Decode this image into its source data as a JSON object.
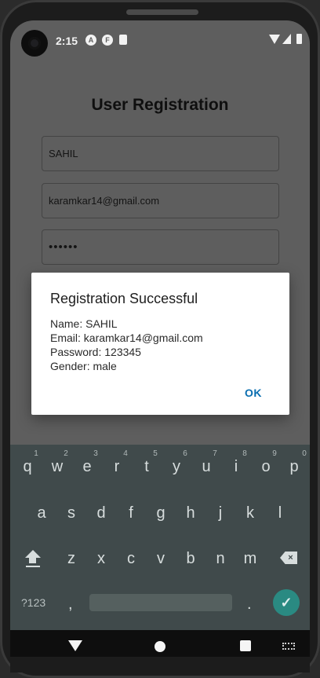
{
  "status_bar": {
    "time": "2:15",
    "icons": [
      "a-icon",
      "f-icon",
      "sd-card-icon",
      "wifi-icon",
      "signal-icon",
      "battery-icon"
    ]
  },
  "app": {
    "title": "User Registration",
    "fields": {
      "name": "SAHIL",
      "email": "karamkar14@gmail.com",
      "password": "••••••"
    }
  },
  "dialog": {
    "title": "Registration Successful",
    "lines": [
      "Name: SAHIL",
      "Email: karamkar14@gmail.com",
      "Password: 123345",
      "Gender: male"
    ],
    "ok_label": "OK"
  },
  "keyboard": {
    "numbers": [
      "1",
      "2",
      "3",
      "4",
      "5",
      "6",
      "7",
      "8",
      "9",
      "0"
    ],
    "row1": [
      "q",
      "w",
      "e",
      "r",
      "t",
      "y",
      "u",
      "i",
      "o",
      "p"
    ],
    "row2": [
      "a",
      "s",
      "d",
      "f",
      "g",
      "h",
      "j",
      "k",
      "l"
    ],
    "row3": [
      "z",
      "x",
      "c",
      "v",
      "b",
      "n",
      "m"
    ],
    "symbols_label": "?123",
    "comma": ",",
    "period": ".",
    "enter_glyph": "✓",
    "backspace_glyph": "×"
  },
  "colors": {
    "accent": "#0a6eb0",
    "enter": "#2a8a82"
  }
}
